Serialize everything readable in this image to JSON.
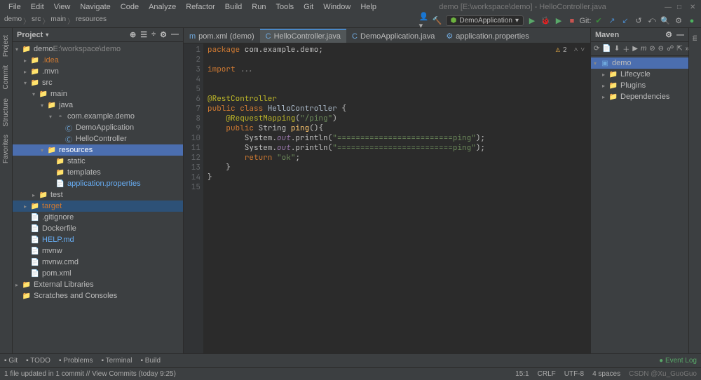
{
  "title": "demo [E:\\workspace\\demo] - HelloController.java",
  "menus": [
    "File",
    "Edit",
    "View",
    "Navigate",
    "Code",
    "Analyze",
    "Refactor",
    "Build",
    "Run",
    "Tools",
    "Git",
    "Window",
    "Help"
  ],
  "breadcrumb": [
    "demo",
    "src",
    "main",
    "resources"
  ],
  "run_config": "DemoApplication",
  "git_label": "Git:",
  "project_tool_label": "Project",
  "left_strip": [
    "Project",
    "Commit",
    "Structure",
    "Favorites"
  ],
  "right_strip": [
    "m"
  ],
  "tree": [
    {
      "d": 0,
      "a": "v",
      "i": "fld",
      "t": "demo",
      "suffix": " E:\\workspace\\demo"
    },
    {
      "d": 1,
      "a": ">",
      "i": "fld",
      "t": ".idea",
      "cls": "red"
    },
    {
      "d": 1,
      "a": ">",
      "i": "fld",
      "t": ".mvn"
    },
    {
      "d": 1,
      "a": "v",
      "i": "src",
      "t": "src"
    },
    {
      "d": 2,
      "a": "v",
      "i": "src",
      "t": "main"
    },
    {
      "d": 3,
      "a": "v",
      "i": "src",
      "t": "java"
    },
    {
      "d": 4,
      "a": "v",
      "i": "pkg",
      "t": "com.example.demo"
    },
    {
      "d": 5,
      "a": "",
      "i": "cls",
      "t": "DemoApplication"
    },
    {
      "d": 5,
      "a": "",
      "i": "cls",
      "t": "HelloController"
    },
    {
      "d": 3,
      "a": "v",
      "i": "fld",
      "t": "resources",
      "sel": true
    },
    {
      "d": 4,
      "a": "",
      "i": "fld",
      "t": "static"
    },
    {
      "d": 4,
      "a": "",
      "i": "fld",
      "t": "templates"
    },
    {
      "d": 4,
      "a": "",
      "i": "file",
      "t": "application.properties",
      "cls": "blue"
    },
    {
      "d": 2,
      "a": ">",
      "i": "src",
      "t": "test"
    },
    {
      "d": 1,
      "a": ">",
      "i": "fld",
      "t": "target",
      "cls": "red",
      "hilite": true
    },
    {
      "d": 1,
      "a": "",
      "i": "file",
      "t": ".gitignore"
    },
    {
      "d": 1,
      "a": "",
      "i": "file",
      "t": "Dockerfile"
    },
    {
      "d": 1,
      "a": "",
      "i": "file",
      "t": "HELP.md",
      "cls": "blue"
    },
    {
      "d": 1,
      "a": "",
      "i": "file",
      "t": "mvnw"
    },
    {
      "d": 1,
      "a": "",
      "i": "file",
      "t": "mvnw.cmd"
    },
    {
      "d": 1,
      "a": "",
      "i": "file",
      "t": "pom.xml"
    },
    {
      "d": 0,
      "a": ">",
      "i": "fld",
      "t": "External Libraries"
    },
    {
      "d": 0,
      "a": "",
      "i": "fld",
      "t": "Scratches and Consoles"
    }
  ],
  "tabs": [
    {
      "label": "pom.xml (demo)",
      "active": false,
      "icon": "m"
    },
    {
      "label": "HelloController.java",
      "active": true,
      "icon": "C"
    },
    {
      "label": "DemoApplication.java",
      "active": false,
      "icon": "C"
    },
    {
      "label": "application.properties",
      "active": false,
      "icon": "⚙"
    }
  ],
  "editor": {
    "warnings": "2",
    "cursor": "15:1",
    "lines": [
      {
        "n": 1,
        "html": "<span class='kw'>package</span> com.example.demo;"
      },
      {
        "n": 2,
        "html": ""
      },
      {
        "n": 3,
        "html": "<span class='kw'>import</span> <span class='cmt'>...</span>"
      },
      {
        "n": 4,
        "html": ""
      },
      {
        "n": 5,
        "html": ""
      },
      {
        "n": 6,
        "html": "<span class='ann2'>@RestController</span>"
      },
      {
        "n": 7,
        "html": "<span class='kw'>public class</span> <span class='cls2'>HelloController</span> {"
      },
      {
        "n": 8,
        "html": "    <span class='ann2'>@RequestMapping</span>(<span class='str'>\"/ping\"</span>)"
      },
      {
        "n": 9,
        "html": "    <span class='kw'>public</span> String <span class='fn'>ping</span>(){"
      },
      {
        "n": 10,
        "html": "        System.<span class='fld2'>out</span>.println(<span class='str'>\"=========================ping\"</span>);"
      },
      {
        "n": 11,
        "html": "        System.<span class='fld2'>out</span>.println(<span class='str'>\"=========================ping\"</span>);"
      },
      {
        "n": 12,
        "html": "        <span class='kw'>return</span> <span class='str'>\"ok\"</span>;"
      },
      {
        "n": 13,
        "html": "    }"
      },
      {
        "n": 14,
        "html": "}"
      },
      {
        "n": 15,
        "html": ""
      }
    ]
  },
  "maven": {
    "title": "Maven",
    "root": "demo",
    "nodes": [
      "Lifecycle",
      "Plugins",
      "Dependencies"
    ]
  },
  "bottom_tools": [
    "Git",
    "TODO",
    "Problems",
    "Terminal",
    "Build"
  ],
  "event_log": "Event Log",
  "status_msg": "1 file updated in 1 commit // View Commits (today 9:25)",
  "status_right": {
    "pos": "15:1",
    "le": "CRLF",
    "enc": "UTF-8",
    "indent": "4 spaces"
  },
  "csdn_mark": "CSDN @Xu_GuoGuo"
}
